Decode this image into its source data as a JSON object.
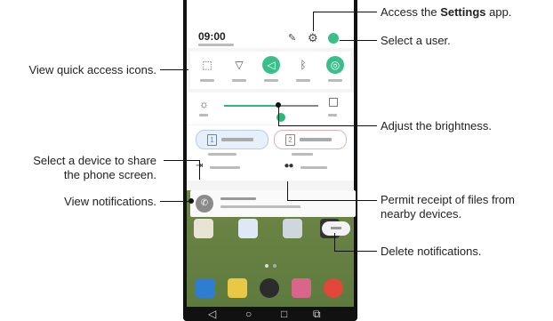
{
  "phone": {
    "time": "09:00"
  },
  "callouts": {
    "settings_prefix": "Access the ",
    "settings_bold": "Settings",
    "settings_suffix": " app.",
    "select_user": "Select a user.",
    "quick_access": "View quick access icons.",
    "brightness": "Adjust the brightness.",
    "share_screen_line1": "Select a device to share",
    "share_screen_line2": "the phone screen.",
    "view_notifications": "View notifications.",
    "permit_files_line1": "Permit receipt of files from",
    "permit_files_line2": "nearby devices.",
    "delete_notifications": "Delete notifications."
  },
  "sim_cards": [
    "1",
    "2"
  ],
  "brightness_level": 0.6,
  "icons": {
    "quick": [
      "screenshot-icon",
      "wifi-icon",
      "sound-icon",
      "bluetooth-icon",
      "rotation-icon"
    ],
    "nav": [
      "back-icon",
      "home-icon",
      "recents-icon",
      "dual-window-icon"
    ]
  },
  "colors": {
    "accent": "#3bbf8a"
  }
}
